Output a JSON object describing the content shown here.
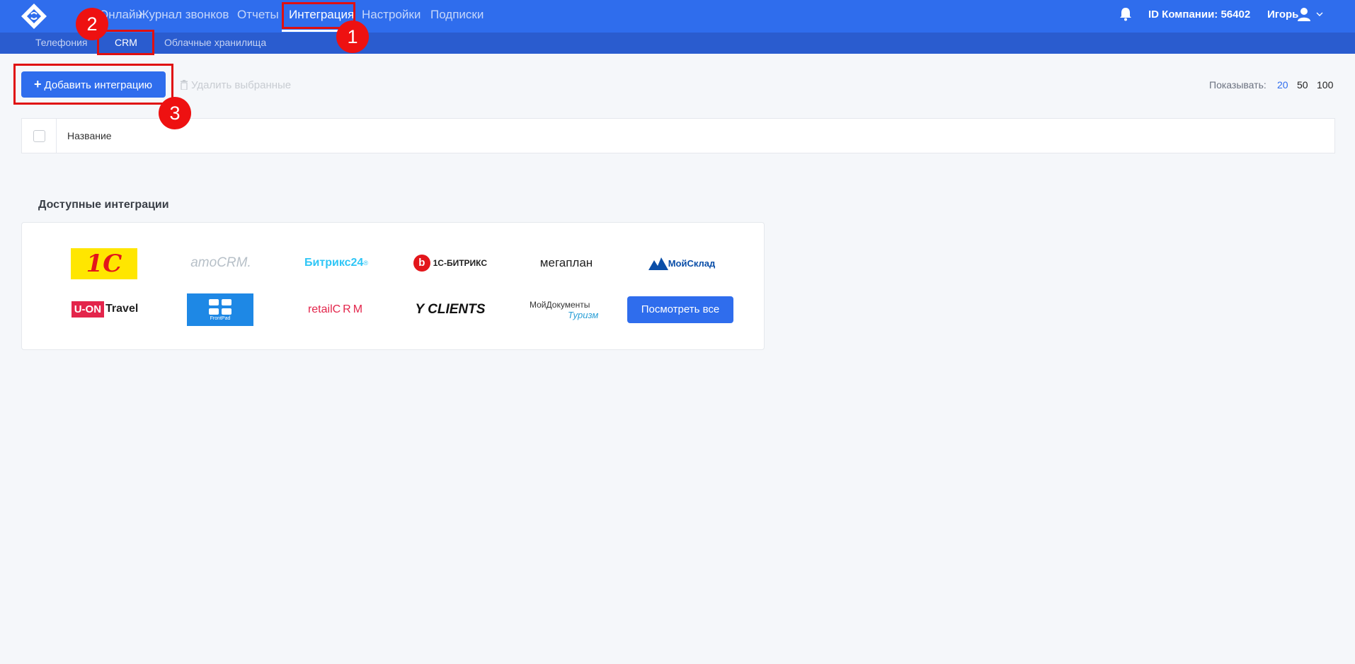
{
  "nav": {
    "items": [
      {
        "label": "Онлайн"
      },
      {
        "label": "Журнал звонков"
      },
      {
        "label": "Отчеты"
      },
      {
        "label": "Интеграция"
      },
      {
        "label": "Настройки"
      },
      {
        "label": "Подписки"
      }
    ],
    "active": "Интеграция",
    "company_id": "ID Компании: 56402",
    "user_name": "Игорь"
  },
  "subnav": {
    "items": [
      {
        "label": "Телефония"
      },
      {
        "label": "CRM"
      },
      {
        "label": "Облачные хранилища"
      }
    ],
    "active": "CRM"
  },
  "toolbar": {
    "add_label": "Добавить интеграцию",
    "delete_label": "Удалить выбранные",
    "show_label": "Показывать:",
    "page_sizes": [
      "20",
      "50",
      "100"
    ],
    "page_size_active": "20"
  },
  "table": {
    "columns": [
      "Название"
    ]
  },
  "integrations": {
    "title": "Доступные интеграции",
    "logos": [
      {
        "name": "1С",
        "text": "1С"
      },
      {
        "name": "amoCRM",
        "text": "amoCRM."
      },
      {
        "name": "Битрикс24",
        "text": "Битрикс24",
        "suffix": "®"
      },
      {
        "name": "1С-Битрикс",
        "text": "1С-БИТРИКС"
      },
      {
        "name": "Мегаплан",
        "text": "мегаплан"
      },
      {
        "name": "МойСклад",
        "text": "МойСклад"
      },
      {
        "name": "U-ON Travel",
        "text_a": "U-ON",
        "text_b": "Travel"
      },
      {
        "name": "FrontPad",
        "text": "FrontPad"
      },
      {
        "name": "retailCRM",
        "text_a": "retail",
        "text_b": "CRM"
      },
      {
        "name": "Y Clients",
        "text": "Y CLIENTS"
      },
      {
        "name": "МойДокументы Туризм",
        "text_a": "МойДокументы",
        "text_b": "Туризм"
      }
    ],
    "view_all_label": "Посмотреть все"
  },
  "annotations": [
    "1",
    "2",
    "3"
  ],
  "colors": {
    "brand": "#2f6ded",
    "brand_dark": "#2a5ccf",
    "annotation": "#e01010",
    "background": "#f5f7fa"
  }
}
